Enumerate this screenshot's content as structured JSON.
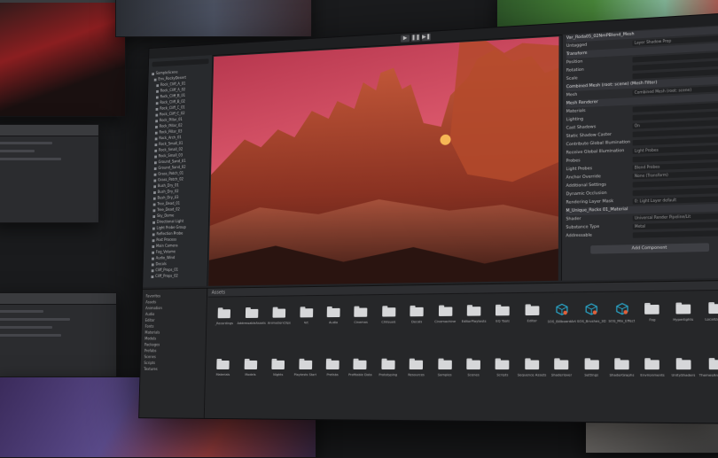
{
  "editor": {
    "toolbar": {
      "play_label": "▶",
      "pause_label": "❚❚",
      "step_label": "▶❚"
    },
    "inspector": {
      "object_name": "Var_Roda05_02NmPBlend_Mesh",
      "tag_label": "Untagged",
      "layer_label": "Layer",
      "layer_value": "Shadow Prop",
      "sections": [
        {
          "label": "Transform",
          "type": "head"
        },
        {
          "label": "Position",
          "value": ""
        },
        {
          "label": "Rotation",
          "value": ""
        },
        {
          "label": "Scale",
          "value": ""
        },
        {
          "label": "Combined Mesh (root: scene) (Mesh Filter)",
          "type": "head"
        },
        {
          "label": "Mesh",
          "value": "Combined Mesh (root: scene)"
        },
        {
          "label": "Mesh Renderer",
          "type": "head"
        },
        {
          "label": "Materials",
          "value": ""
        },
        {
          "label": "Lighting",
          "value": ""
        },
        {
          "label": "Cast Shadows",
          "value": "On"
        },
        {
          "label": "Static Shadow Caster",
          "value": ""
        },
        {
          "label": "Contribute Global Illumination",
          "value": ""
        },
        {
          "label": "Receive Global Illumination",
          "value": "Light Probes"
        },
        {
          "label": "Probes",
          "value": ""
        },
        {
          "label": "Light Probes",
          "value": "Blend Probes"
        },
        {
          "label": "Anchor Override",
          "value": "None (Transform)"
        },
        {
          "label": "Additional Settings",
          "value": ""
        },
        {
          "label": "Dynamic Occlusion",
          "value": ""
        },
        {
          "label": "Rendering Layer Mask",
          "value": "0: Light Layer default"
        },
        {
          "label": "M_Unique_Rocks 01_Material",
          "type": "head"
        },
        {
          "label": "Shader",
          "value": "Universal Render Pipeline/Lit"
        },
        {
          "label": "Substance Type",
          "value": "Metal"
        },
        {
          "label": "Addressable",
          "value": ""
        }
      ],
      "add_component_label": "Add Component"
    },
    "hierarchy": {
      "rows": [
        "SampleScene",
        "Env_RockyDesert",
        "Rock_Cliff_A_01",
        "Rock_Cliff_A_02",
        "Rock_Cliff_B_01",
        "Rock_Cliff_B_02",
        "Rock_Cliff_C_01",
        "Rock_Cliff_C_02",
        "Rock_Pillar_01",
        "Rock_Pillar_02",
        "Rock_Pillar_03",
        "Rock_Arch_01",
        "Rock_Small_01",
        "Rock_Small_02",
        "Rock_Small_03",
        "Ground_Sand_01",
        "Ground_Sand_02",
        "Grass_Patch_01",
        "Grass_Patch_02",
        "Bush_Dry_01",
        "Bush_Dry_02",
        "Bush_Dry_03",
        "Tree_Dead_01",
        "Tree_Dead_02",
        "Sky_Dome",
        "Directional Light",
        "Light Probe Group",
        "Reflection Probe",
        "Post Process",
        "Main Camera",
        "Fog_Volume",
        "Audio_Wind",
        "Decals",
        "Cliff_Props_01",
        "Cliff_Props_02"
      ]
    },
    "project": {
      "tab_label": "Assets",
      "tree_rows": [
        "Favorites",
        "Assets",
        "Animation",
        "Audio",
        "Editor",
        "Fonts",
        "Materials",
        "Models",
        "Packages",
        "Prefabs",
        "Scenes",
        "Scripts",
        "Textures"
      ],
      "assets": [
        {
          "label": "_Recordings",
          "kind": "folder"
        },
        {
          "label": "AddressableAssets",
          "kind": "folder"
        },
        {
          "label": "AnimationClips",
          "kind": "folder"
        },
        {
          "label": "Art",
          "kind": "folder"
        },
        {
          "label": "Audio",
          "kind": "folder"
        },
        {
          "label": "Cinemas",
          "kind": "folder"
        },
        {
          "label": "CIVisuals",
          "kind": "folder"
        },
        {
          "label": "Decals",
          "kind": "folder"
        },
        {
          "label": "Cinemachine",
          "kind": "folder"
        },
        {
          "label": "EditorPlaytests",
          "kind": "folder"
        },
        {
          "label": "EQ Tools",
          "kind": "folder"
        },
        {
          "label": "Editor",
          "kind": "folder"
        },
        {
          "label": "SOS_BillboardArt",
          "kind": "prefab"
        },
        {
          "label": "SOS_Brushes_3D",
          "kind": "prefab"
        },
        {
          "label": "SOS_Mix_Effect",
          "kind": "prefab"
        },
        {
          "label": "Fog",
          "kind": "folder"
        },
        {
          "label": "Hyperlights",
          "kind": "folder"
        },
        {
          "label": "Localization",
          "kind": "folder"
        },
        {
          "label": "Materials",
          "kind": "folder"
        },
        {
          "label": "Models",
          "kind": "folder"
        },
        {
          "label": "Nights",
          "kind": "folder"
        },
        {
          "label": "Playtests Start",
          "kind": "folder"
        },
        {
          "label": "Prefabs",
          "kind": "folder"
        },
        {
          "label": "Profitable Data",
          "kind": "folder"
        },
        {
          "label": "Prototyping",
          "kind": "folder"
        },
        {
          "label": "Resources",
          "kind": "folder"
        },
        {
          "label": "Samples",
          "kind": "folder"
        },
        {
          "label": "Scenes",
          "kind": "folder"
        },
        {
          "label": "Scripts",
          "kind": "folder"
        },
        {
          "label": "Sequence Assets",
          "kind": "folder"
        },
        {
          "label": "Shaderlover",
          "kind": "folder"
        },
        {
          "label": "Settings",
          "kind": "folder"
        },
        {
          "label": "ShaderGraphs",
          "kind": "folder"
        },
        {
          "label": "Environments",
          "kind": "folder"
        },
        {
          "label": "UnityShaders",
          "kind": "folder"
        },
        {
          "label": "ThemesAndPresets",
          "kind": "folder"
        }
      ]
    }
  },
  "colors": {
    "accent": "#29a6c9",
    "sky_top": "#c9405a",
    "sky_bottom": "#f0a04a",
    "rock": "#b0462e"
  }
}
